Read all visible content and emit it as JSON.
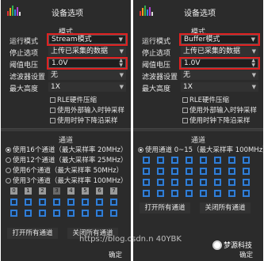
{
  "left": {
    "window_title": "设备选项",
    "mode_section_title": "模式",
    "labels": [
      "运行模式",
      "停止选项",
      "阈值电压",
      "滤波器设置",
      "最大高度"
    ],
    "run_mode_value": "Stream模式",
    "stop_option_value": "上传已采集的数据",
    "threshold_value": "1.0V",
    "filter_value": "无",
    "max_height_value": "1X",
    "checkboxes": [
      "RLE硬件压缩",
      "使用外部输入时钟采样",
      "使用时钟下降沿采样"
    ],
    "channel_section_title": "通道",
    "radios": [
      "使用16个通道（最大采样率 20MHz）",
      "使用12个通道（最大采样率 25MHz）",
      "使用6个通道（最大采样率 50MHz）",
      "使用3个通道（最大采样率 100MHz）"
    ],
    "channel_numbers": [
      "0",
      "1",
      "2",
      "3",
      "4",
      "5",
      "6",
      "7"
    ],
    "open_all_label": "打开所有通道",
    "close_all_label": "关闭所有通道",
    "confirm_label": "确定"
  },
  "right": {
    "window_title": "设备选项",
    "mode_section_title": "模式",
    "labels": [
      "运行模式",
      "停止选项",
      "阈值电压",
      "滤波器设置",
      "最大高度"
    ],
    "run_mode_value": "Buffer模式",
    "stop_option_value": "上传已采集的数据",
    "threshold_value": "1.0V",
    "filter_value": "无",
    "max_height_value": "1X",
    "checkboxes": [
      "RLE硬件压缩",
      "使用外部输入时钟采样",
      "使用时钟下降沿采样"
    ],
    "channel_section_title": "通道",
    "radios": [
      "使用通道 0~15（最大采样率 100MHz）"
    ],
    "open_all_label": "打开所有通道",
    "close_all_label": "关闭所有通道",
    "confirm_label": "确定"
  },
  "watermark": {
    "url": "https://blog.csdn.n",
    "badge_text": "梦源科技",
    "overlay_text": "40YBK"
  },
  "colors": {
    "panel_bg": "#2b2b2b",
    "highlight_red": "#e02020",
    "channel_blue": "#2f7ed8"
  }
}
